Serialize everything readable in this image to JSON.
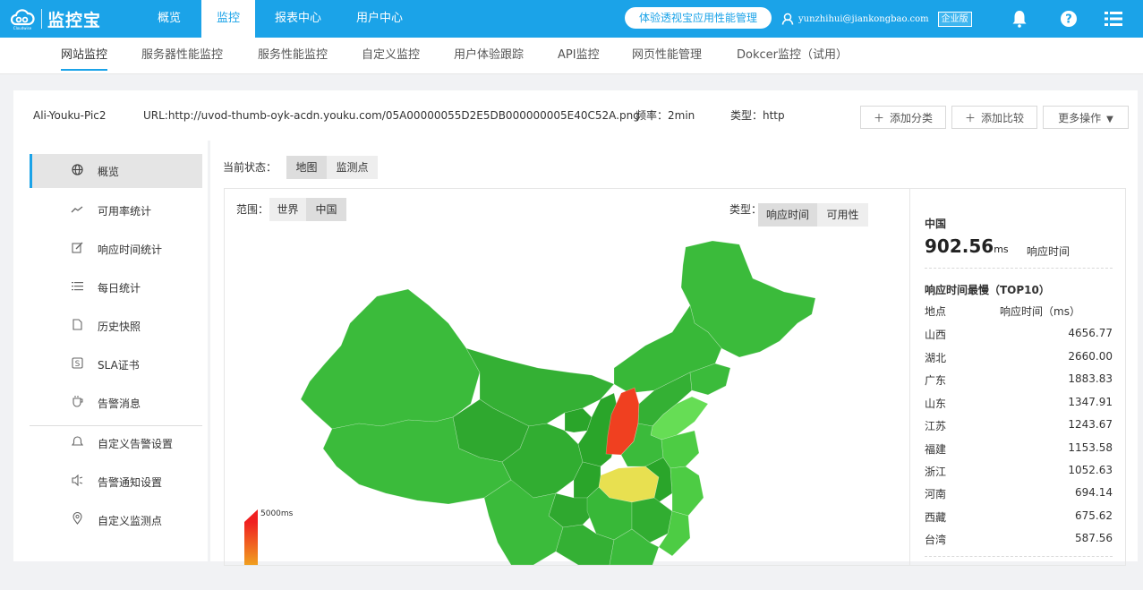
{
  "colors": {
    "brand": "#1ba3e8",
    "map_green_dark": "#2aa52a",
    "map_green": "#3bbb3b",
    "map_green_light": "#66dd55",
    "map_yellow": "#e8e050",
    "map_red": "#f04020"
  },
  "brand": {
    "name": "监控宝"
  },
  "topnav": {
    "items": [
      {
        "label": "概览"
      },
      {
        "label": "监控"
      },
      {
        "label": "报表中心"
      },
      {
        "label": "用户中心"
      }
    ],
    "active": "监控",
    "trial_button": "体验透视宝应用性能管理",
    "user_email": "yunzhihui@jiankongbao.com",
    "edition_badge": "企业版",
    "icons": [
      "bell-icon",
      "help-icon",
      "menu-icon"
    ]
  },
  "subnav": {
    "items": [
      {
        "label": "网站监控"
      },
      {
        "label": "服务器性能监控"
      },
      {
        "label": "服务性能监控"
      },
      {
        "label": "自定义监控"
      },
      {
        "label": "用户体验跟踪"
      },
      {
        "label": "API监控"
      },
      {
        "label": "网页性能管理"
      },
      {
        "label": "Dokcer监控（试用）"
      }
    ],
    "active": "网站监控"
  },
  "monitor": {
    "name": "Ali-Youku-Pic2",
    "url": "URL:http://uvod-thumb-oyk-acdn.youku.com/05A00000055D2E5DB000000005E40C52A.png",
    "frequency": "频率：2min",
    "type": "类型：http",
    "buttons": {
      "add_category": "添加分类",
      "add_compare": "添加比较",
      "more_actions": "更多操作"
    }
  },
  "sidebar": {
    "items": [
      {
        "label": "概览",
        "icon": "globe-icon",
        "active": true
      },
      {
        "label": "可用率统计",
        "icon": "trend-icon"
      },
      {
        "label": "响应时间统计",
        "icon": "edit-icon"
      },
      {
        "label": "每日统计",
        "icon": "list-icon"
      },
      {
        "label": "历史快照",
        "icon": "document-icon"
      },
      {
        "label": "SLA证书",
        "icon": "sla-icon"
      },
      {
        "label": "告警消息",
        "icon": "cup-icon"
      },
      {
        "label": "自定义告警设置",
        "icon": "alarm-settings-icon"
      },
      {
        "label": "告警通知设置",
        "icon": "notify-icon"
      },
      {
        "label": "自定义监测点",
        "icon": "location-icon"
      }
    ]
  },
  "main": {
    "status_label": "当前状态：",
    "view_tabs": [
      "地图",
      "监测点"
    ],
    "active_view": "地图",
    "scope_label": "范围：",
    "scope_tabs": [
      "世界",
      "中国"
    ],
    "active_scope": "中国",
    "type_label": "类型：",
    "type_tabs": [
      "响应时间",
      "可用性"
    ],
    "active_type": "响应时间",
    "legend_max": "5000ms"
  },
  "summary": {
    "region": "中国",
    "value": "902.56",
    "unit": "ms",
    "metric": "响应时间",
    "top_title": "响应时间最慢（TOP10）",
    "col_place": "地点",
    "col_time": "响应时间（ms）",
    "rows": [
      {
        "place": "山西",
        "time": "4656.77"
      },
      {
        "place": "湖北",
        "time": "2660.00"
      },
      {
        "place": "广东",
        "time": "1883.83"
      },
      {
        "place": "山东",
        "time": "1347.91"
      },
      {
        "place": "江苏",
        "time": "1243.67"
      },
      {
        "place": "福建",
        "time": "1153.58"
      },
      {
        "place": "浙江",
        "time": "1052.63"
      },
      {
        "place": "河南",
        "time": "694.14"
      },
      {
        "place": "西藏",
        "time": "675.62"
      },
      {
        "place": "台湾",
        "time": "587.56"
      }
    ]
  }
}
